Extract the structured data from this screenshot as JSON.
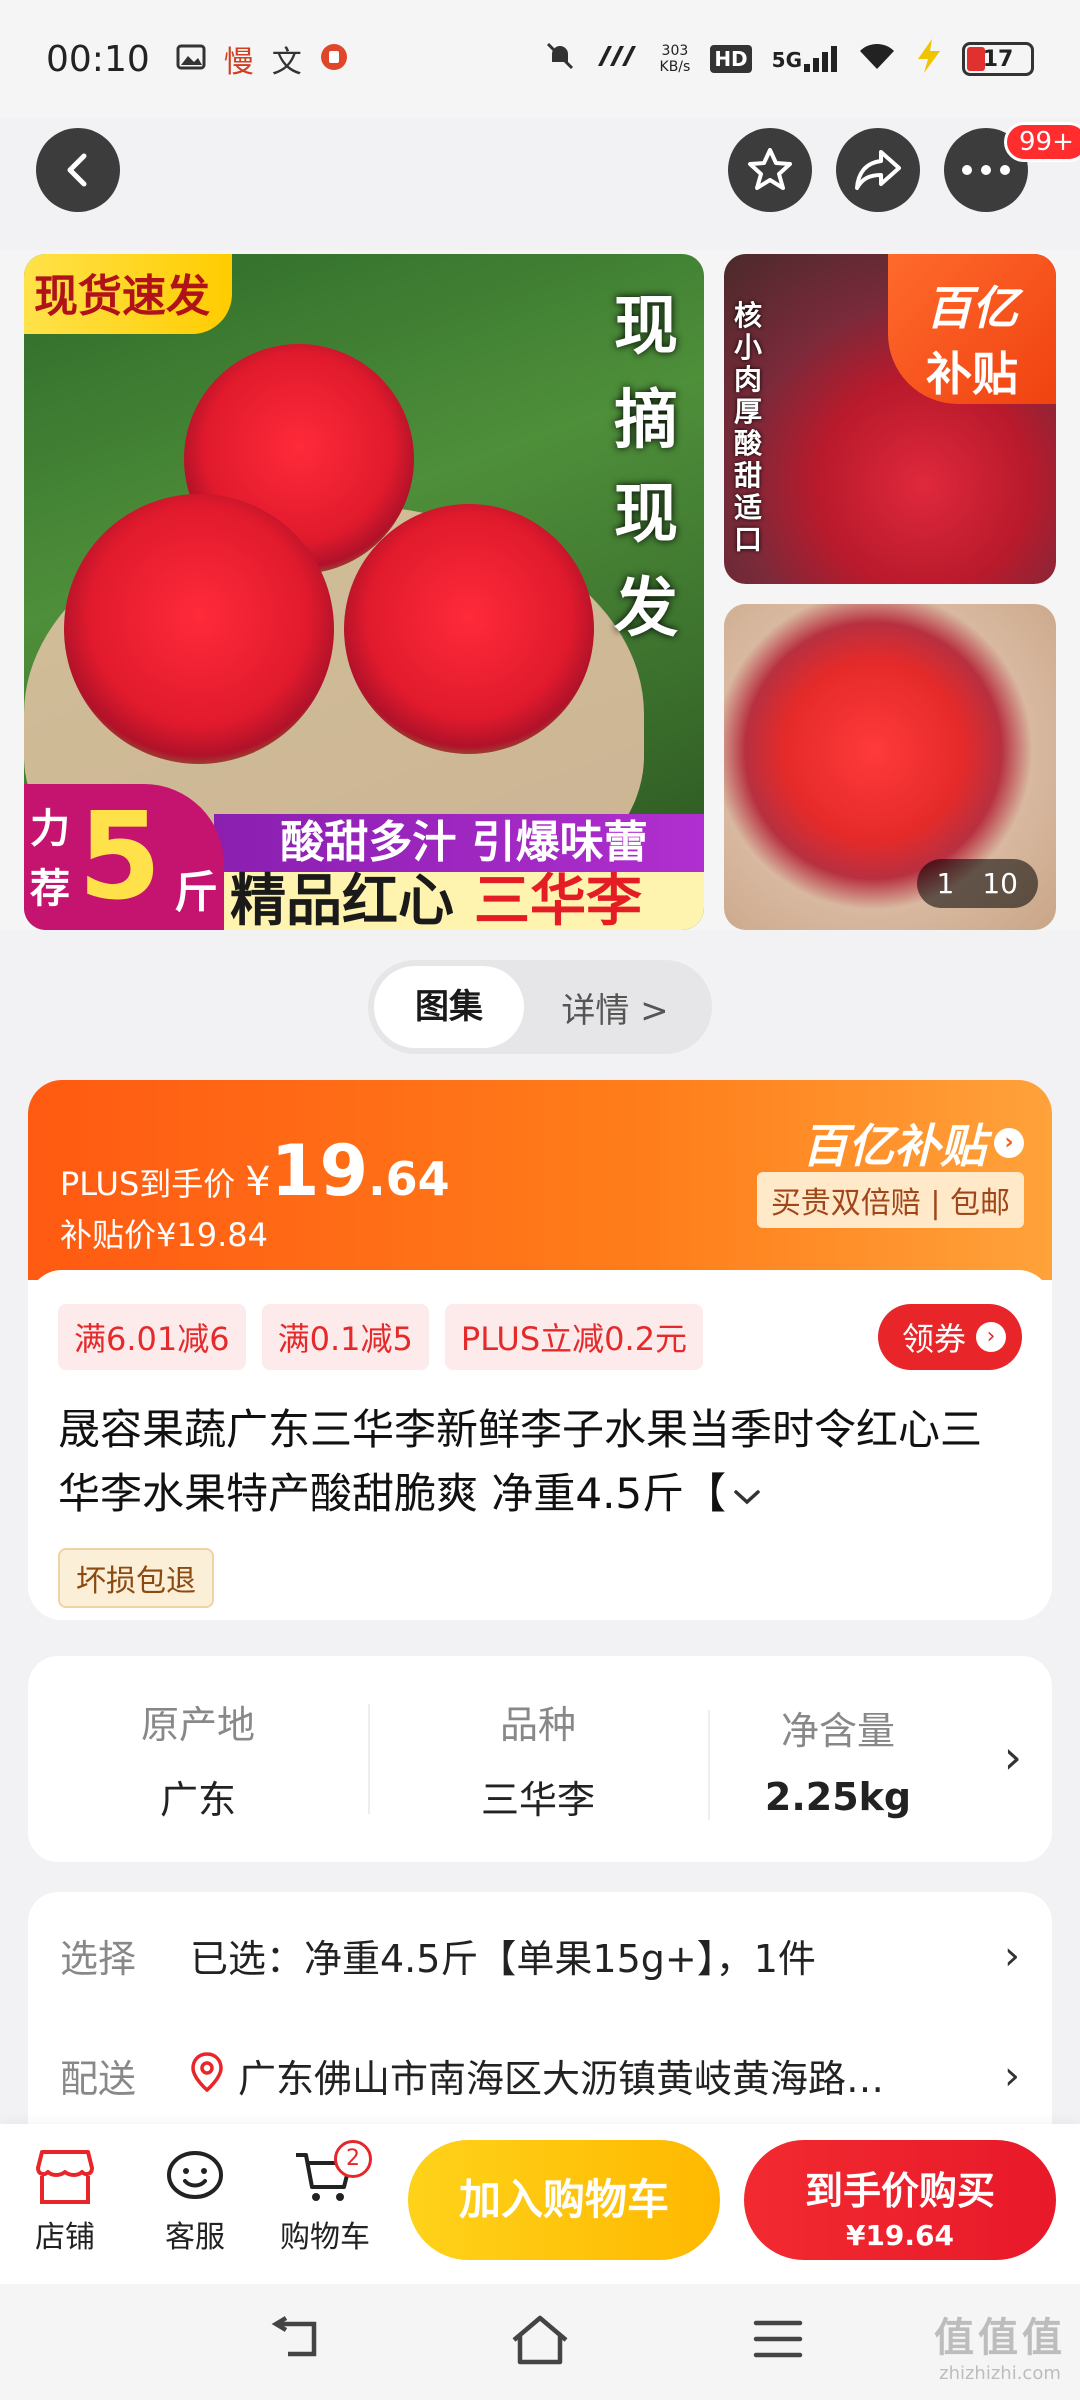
{
  "status": {
    "time": "00:10",
    "app_icons": [
      "慢",
      "文"
    ],
    "speed_value": "303",
    "speed_unit": "KB/s",
    "hd": "HD",
    "network": "5G",
    "battery": "17"
  },
  "nav": {
    "more_badge": "99+"
  },
  "gallery": {
    "main": {
      "tag_spot": "现货速发",
      "vertical_text": "现摘现发",
      "rec_a": "力",
      "rec_b": "荐",
      "rec_num": "5",
      "rec_unit": "斤",
      "slogan": "酸甜多汁 引爆味蕾",
      "name_prefix": "精品红心",
      "name_highlight": "三华李"
    },
    "side_top": {
      "vertical_text": "核小肉厚酸甜适口",
      "subsidy_line1": "百亿",
      "subsidy_line2": "补贴"
    },
    "counter_current": "1",
    "counter_total": "10"
  },
  "toggle": {
    "active": "图集",
    "inactive": "详情 >"
  },
  "price": {
    "plus_label": "PLUS到手价",
    "currency": "¥",
    "int_part": "19",
    "dec_part": ".64",
    "subsidy_price": "补贴价¥19.84",
    "subsidy_logo": "百亿补贴",
    "guarantee": "买贵双倍赔 | 包邮"
  },
  "coupons": [
    "满6.01减6",
    "满0.1减5",
    "PLUS立减0.2元"
  ],
  "get_coupon": "领券",
  "product_title": "晟容果蔬广东三华李新鲜李子水果当季时令红心三华李水果特产酸甜脆爽 净重4.5斤【",
  "return_tag": "坏损包退",
  "attributes": [
    {
      "key": "原产地",
      "value": "广东"
    },
    {
      "key": "品种",
      "value": "三华李"
    },
    {
      "key": "净含量",
      "value": "2.25kg"
    }
  ],
  "options": {
    "select_label": "选择",
    "select_value": "已选：净重4.5斤【单果15g+】，1件",
    "ship_label": "配送",
    "ship_value": "广东佛山市南海区大沥镇黄岐黄海路…"
  },
  "bottom": {
    "shop": "店铺",
    "service": "客服",
    "cart": "购物车",
    "cart_count": "2",
    "add_cart": "加入购物车",
    "buy": "到手价购买",
    "buy_price": "¥19.64"
  },
  "watermark": {
    "main": "值值值",
    "url": "zhizhizhi.com"
  },
  "colors": {
    "accent_red": "#e8262a",
    "accent_orange": "#ff5a12",
    "cart_yellow": "#ffc20e"
  }
}
